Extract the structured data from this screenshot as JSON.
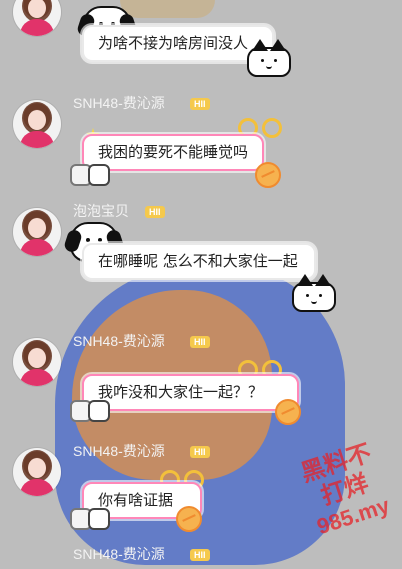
{
  "messages": [
    {
      "name": "",
      "badge": "",
      "text": "为啥不接为啥房间没人",
      "theme": "gray"
    },
    {
      "name": "SNH48-费沁源",
      "badge": "HII",
      "text": "我困的要死不能睡觉吗",
      "theme": "pink"
    },
    {
      "name": "泡泡宝贝",
      "badge": "HII",
      "text": "在哪睡呢 怎么不和大家住一起",
      "theme": "gray"
    },
    {
      "name": "SNH48-费沁源",
      "badge": "HII",
      "text": "我咋没和大家住一起？？",
      "theme": "pink"
    },
    {
      "name": "SNH48-费沁源",
      "badge": "HII",
      "text": "你有啥证据",
      "theme": "pink"
    },
    {
      "name": "SNH48-费沁源",
      "badge": "HII",
      "text": "",
      "theme": "pink"
    }
  ],
  "watermark": {
    "line1": "黑料不打烊",
    "line2": "985.my"
  },
  "colors": {
    "badge": "#f5c94d",
    "pink_border": "#ff87b8",
    "name": "#f3f3f3"
  }
}
